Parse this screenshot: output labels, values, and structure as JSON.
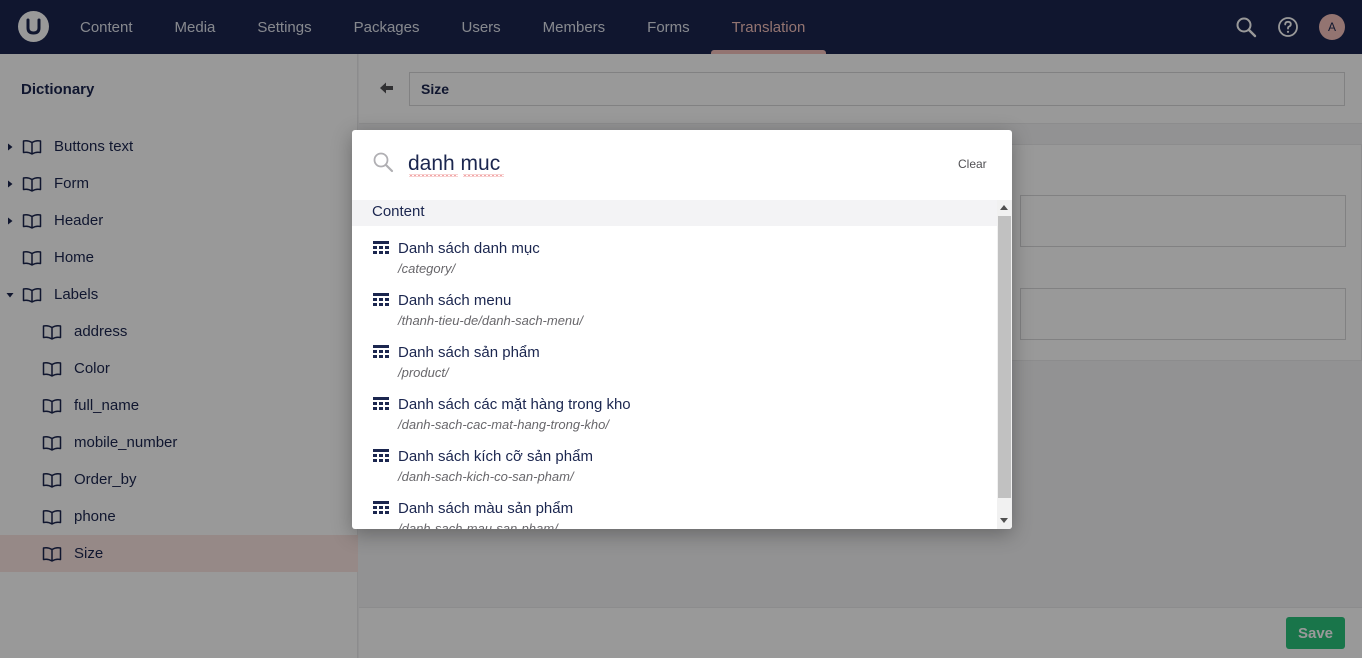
{
  "topbar": {
    "logo_letter": "U",
    "nav": [
      "Content",
      "Media",
      "Settings",
      "Packages",
      "Users",
      "Members",
      "Forms",
      "Translation"
    ],
    "active_nav": "Translation",
    "avatar_initial": "A",
    "colors": {
      "bar": "#1b264f",
      "active": "#f5c1bc"
    }
  },
  "sidebar": {
    "title": "Dictionary",
    "items": [
      {
        "label": "Buttons text",
        "caret": "right",
        "depth": 0
      },
      {
        "label": "Form",
        "caret": "right",
        "depth": 0
      },
      {
        "label": "Header",
        "caret": "right",
        "depth": 0
      },
      {
        "label": "Home",
        "caret": "none",
        "depth": 0
      },
      {
        "label": "Labels",
        "caret": "down",
        "depth": 0
      },
      {
        "label": "address",
        "caret": "none",
        "depth": 1
      },
      {
        "label": "Color",
        "caret": "none",
        "depth": 1
      },
      {
        "label": "full_name",
        "caret": "none",
        "depth": 1
      },
      {
        "label": "mobile_number",
        "caret": "none",
        "depth": 1
      },
      {
        "label": "Order_by",
        "caret": "none",
        "depth": 1
      },
      {
        "label": "phone",
        "caret": "none",
        "depth": 1
      },
      {
        "label": "Size",
        "caret": "none",
        "depth": 1,
        "selected": true
      }
    ]
  },
  "editor": {
    "name_value": "Size",
    "save_label": "Save",
    "save_color": "#2bc37c"
  },
  "search": {
    "query": "danh muc",
    "clear_label": "Clear",
    "section": "Content",
    "results": [
      {
        "name": "Danh sách danh mục",
        "url": "/category/"
      },
      {
        "name": "Danh sách menu",
        "url": "/thanh-tieu-de/danh-sach-menu/"
      },
      {
        "name": "Danh sách sản phẩm",
        "url": "/product/"
      },
      {
        "name": "Danh sách các mặt hàng trong kho",
        "url": "/danh-sach-cac-mat-hang-trong-kho/"
      },
      {
        "name": "Danh sách kích cỡ sản phẩm",
        "url": "/danh-sach-kich-co-san-pham/"
      },
      {
        "name": "Danh sách màu sản phẩm",
        "url": "/danh-sach-mau-san-pham/"
      }
    ]
  }
}
